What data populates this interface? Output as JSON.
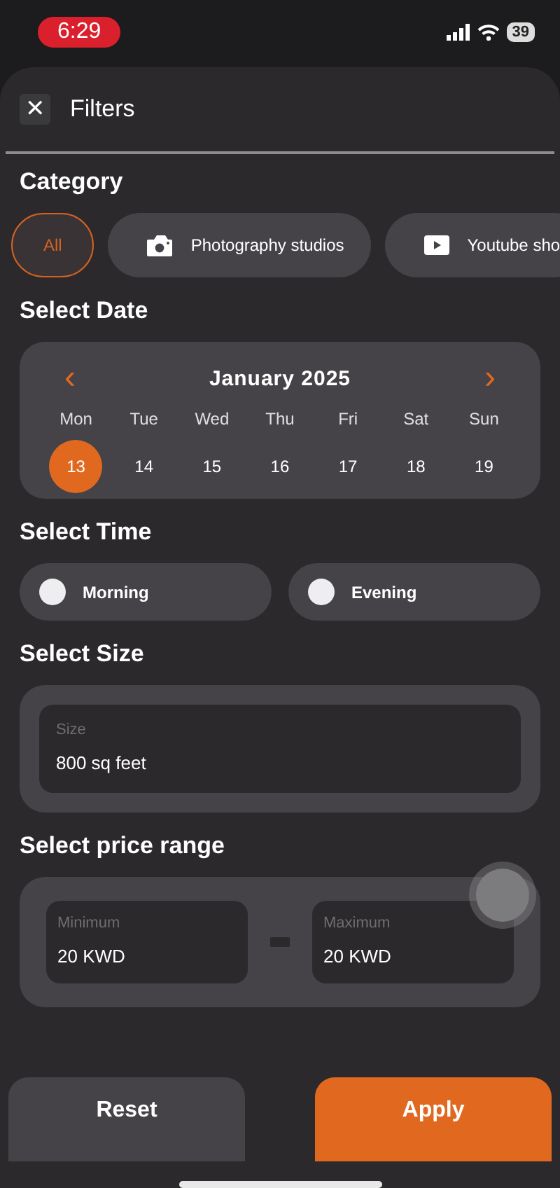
{
  "status_bar": {
    "time": "6:29",
    "battery": "39"
  },
  "header": {
    "close_icon": "✕",
    "title": "Filters"
  },
  "category": {
    "title": "Category",
    "chips": [
      {
        "label": "All",
        "kind": "plain",
        "selected": true
      },
      {
        "label": "Photography studios",
        "kind": "camera",
        "selected": false
      },
      {
        "label": "Youtube sho",
        "kind": "video",
        "selected": false
      }
    ]
  },
  "date": {
    "title": "Select Date",
    "month": "January 2025",
    "prev": "‹",
    "next": "›",
    "days": [
      {
        "weekday": "Mon",
        "day": "13",
        "selected": true
      },
      {
        "weekday": "Tue",
        "day": "14",
        "selected": false
      },
      {
        "weekday": "Wed",
        "day": "15",
        "selected": false
      },
      {
        "weekday": "Thu",
        "day": "16",
        "selected": false
      },
      {
        "weekday": "Fri",
        "day": "17",
        "selected": false
      },
      {
        "weekday": "Sat",
        "day": "18",
        "selected": false
      },
      {
        "weekday": "Sun",
        "day": "19",
        "selected": false
      }
    ]
  },
  "time": {
    "title": "Select Time",
    "options": [
      {
        "label": "Morning",
        "selected": false
      },
      {
        "label": "Evening",
        "selected": false
      }
    ]
  },
  "size": {
    "title": "Select Size",
    "field": {
      "label": "Size",
      "value": "800 sq feet"
    }
  },
  "price": {
    "title": "Select price range",
    "minimum": {
      "label": "Minimum",
      "value": "20 KWD"
    },
    "maximum": {
      "label": "Maximum",
      "value": "20 KWD"
    }
  },
  "actions": [
    {
      "label": "Reset",
      "kind": "secondary"
    },
    {
      "label": "Apply",
      "kind": "primary"
    }
  ]
}
